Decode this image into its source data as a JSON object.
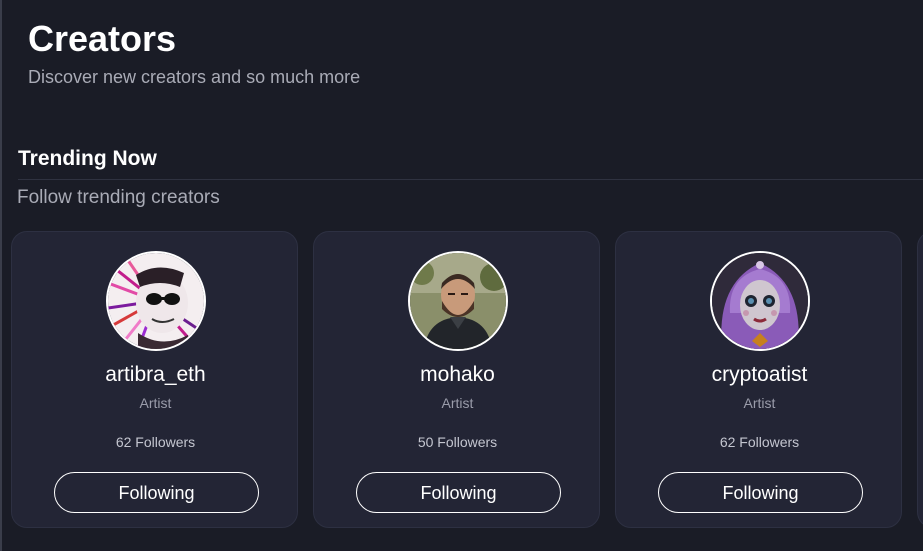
{
  "header": {
    "title": "Creators",
    "subtitle": "Discover new creators and so much more"
  },
  "trending": {
    "title": "Trending Now",
    "subtitle": "Follow trending creators",
    "creators": [
      {
        "name": "artibra_eth",
        "role": "Artist",
        "followers": "62 Followers",
        "button_label": "Following",
        "avatar_icon": "abstract-portrait-avatar"
      },
      {
        "name": "mohako",
        "role": "Artist",
        "followers": "50 Followers",
        "button_label": "Following",
        "avatar_icon": "bearded-man-avatar"
      },
      {
        "name": "cryptoatist",
        "role": "Artist",
        "followers": "62 Followers",
        "button_label": "Following",
        "avatar_icon": "purple-doll-avatar"
      }
    ]
  },
  "colors": {
    "background": "#1a1c26",
    "card": "#232535",
    "muted_text": "#a9abb6"
  }
}
